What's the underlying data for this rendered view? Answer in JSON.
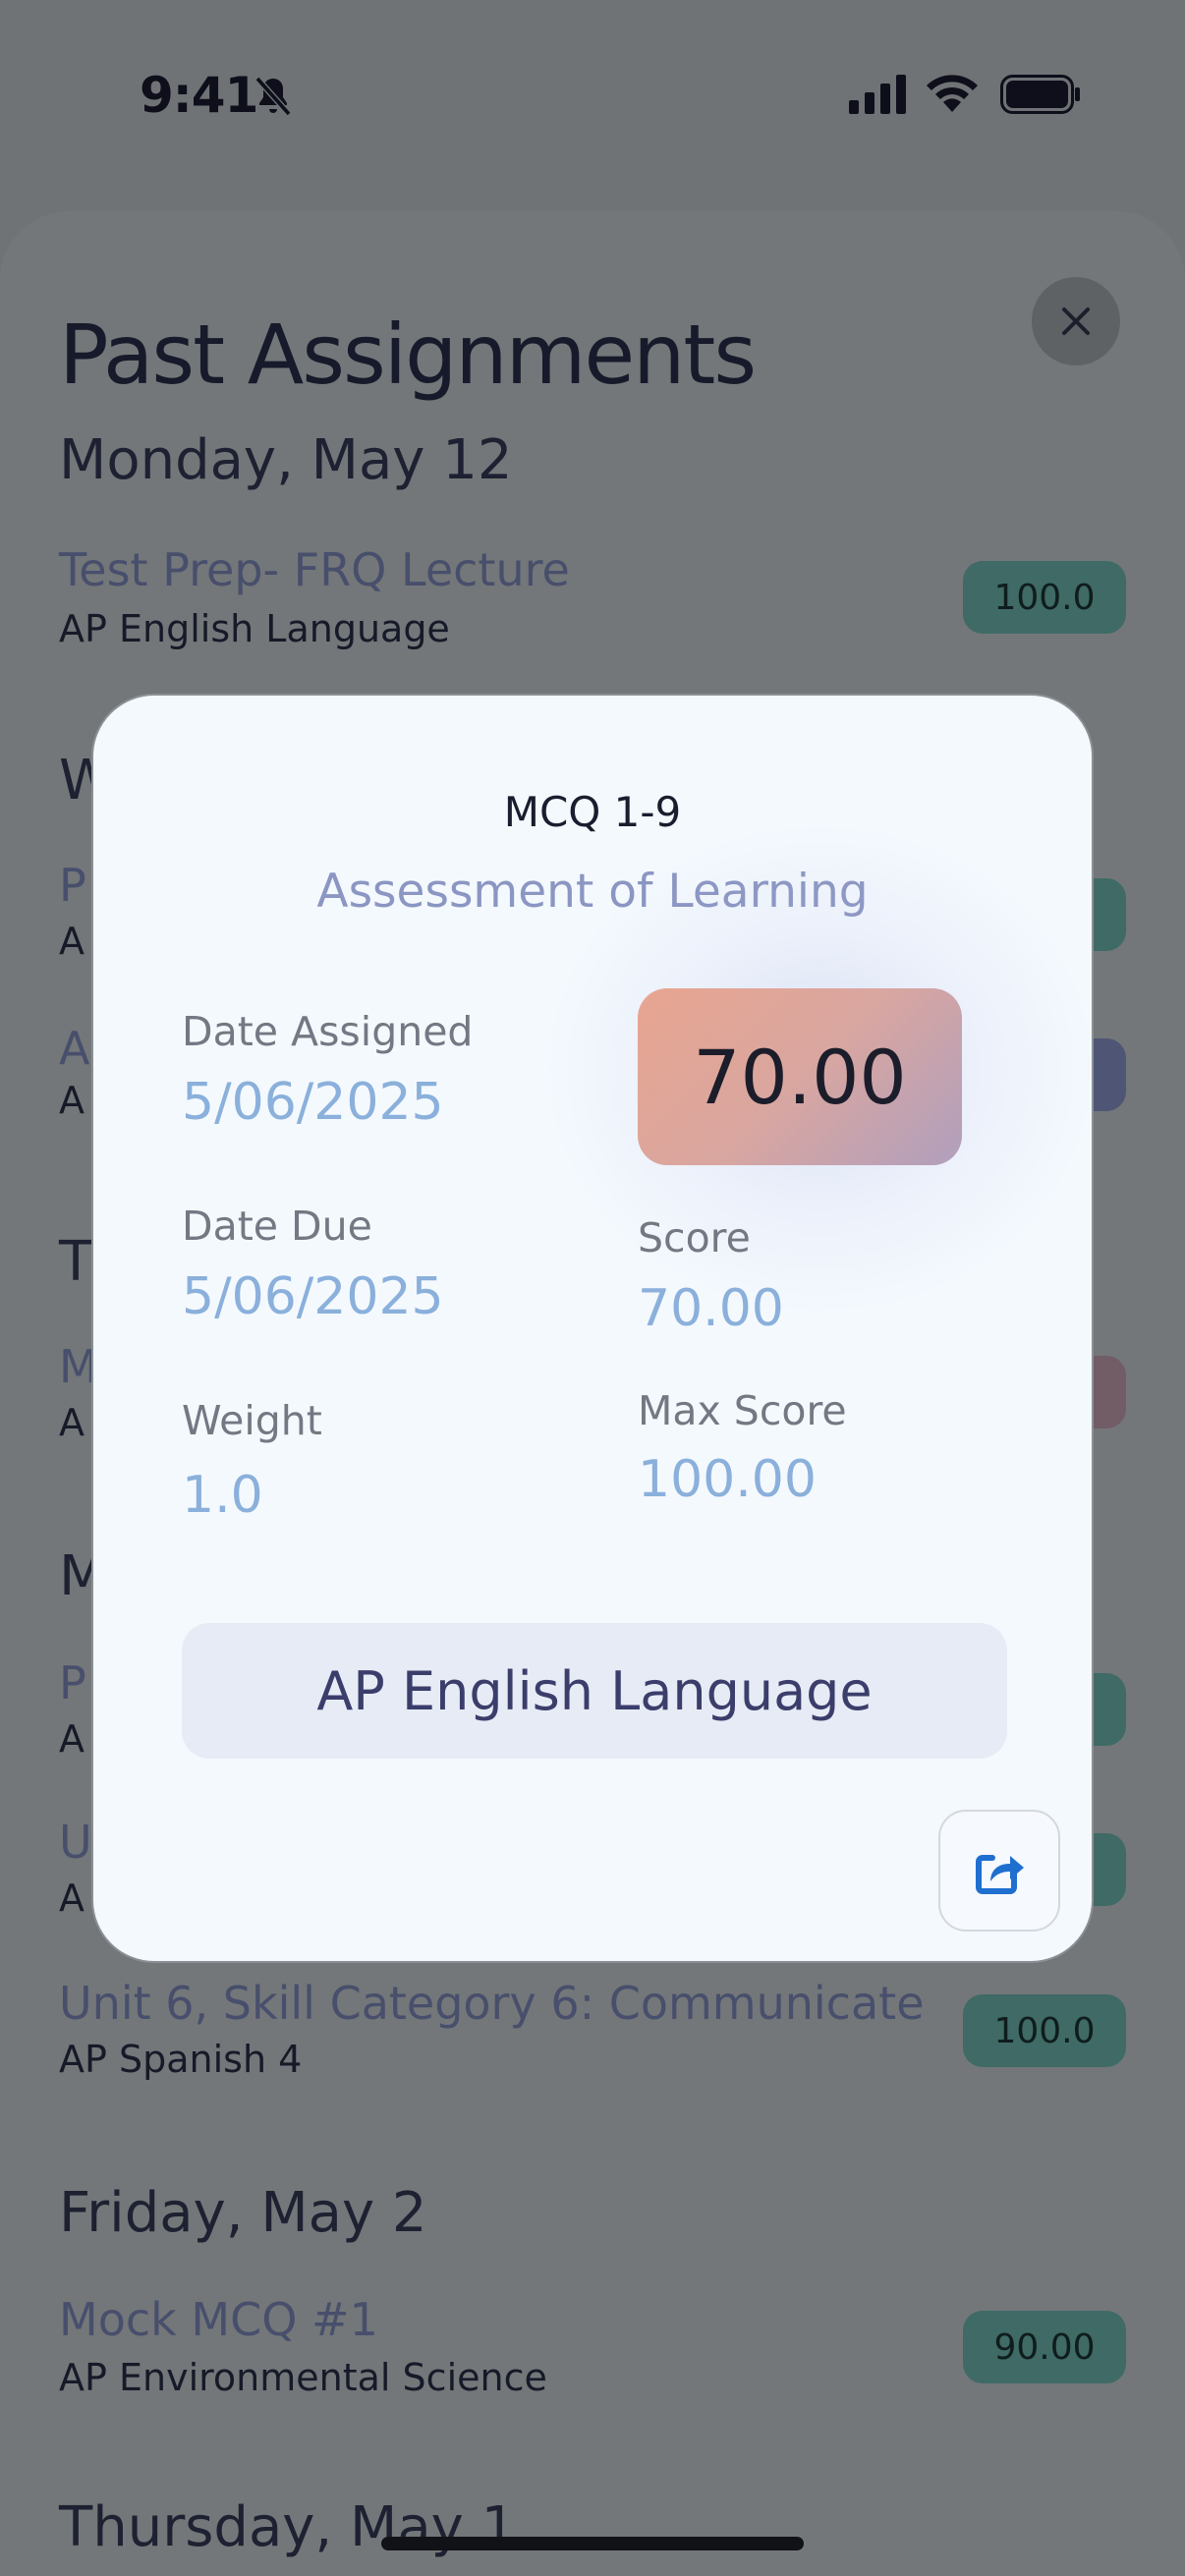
{
  "status": {
    "time": "9:41"
  },
  "sheet": {
    "title": "Past Assignments",
    "days": [
      {
        "label": "Monday, May 12",
        "items": [
          {
            "title": "Test Prep- FRQ Lecture",
            "course": "AP English Language",
            "score": "100.0"
          }
        ]
      },
      {
        "label": "Friday, May 2",
        "items": [
          {
            "title": "Mock MCQ #1",
            "course": "AP Environmental Science",
            "score": "90.00"
          }
        ]
      },
      {
        "label": "Thursday, May 1"
      }
    ],
    "partial_headers": [
      "W",
      "T",
      "M"
    ],
    "partial_lines": [
      "P",
      "A",
      "A",
      "A",
      "M",
      "A",
      "P",
      "A",
      "U",
      "A"
    ],
    "extra_item": {
      "title": "Unit 6, Skill Category 6: Communicate",
      "course": "AP Spanish 4",
      "score": "100.0"
    },
    "badge_colors": {
      "green": "#3f6a66",
      "navy": "#4e5575",
      "mauve": "#725c66"
    }
  },
  "modal": {
    "title": "MCQ 1-9",
    "category": "Assessment of Learning",
    "date_assigned_label": "Date Assigned",
    "date_assigned": "5/06/2025",
    "date_due_label": "Date Due",
    "date_due": "5/06/2025",
    "weight_label": "Weight",
    "weight": "1.0",
    "score_display": "70.00",
    "score_label": "Score",
    "score": "70.00",
    "max_score_label": "Max Score",
    "max_score": "100.00",
    "course": "AP English Language",
    "icons": {
      "share": "share-icon",
      "close": "close-icon"
    }
  }
}
